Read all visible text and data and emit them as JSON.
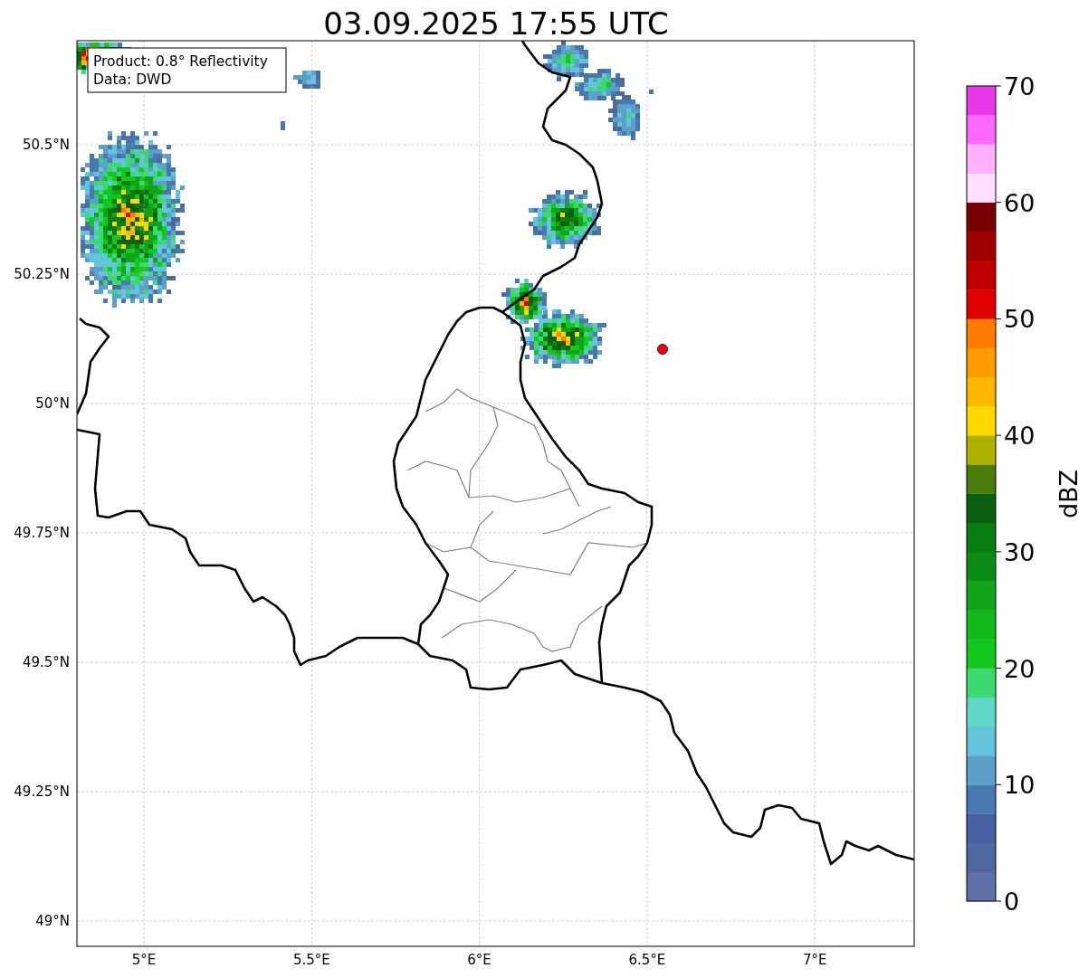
{
  "title": "03.09.2025 17:55 UTC",
  "map": {
    "info_box": [
      "Product: 0.8° Reflectivity",
      "Data: DWD"
    ],
    "lat_ticks": [
      "50.5°N",
      "50.25°N",
      "50°N",
      "49.75°N",
      "49.5°N",
      "49.25°N",
      "49°N"
    ],
    "lon_ticks": [
      "5°E",
      "5.5°E",
      "6°E",
      "6.5°E",
      "7°E"
    ]
  },
  "colorbar": {
    "label": "dBZ",
    "ticks": [
      "70",
      "60",
      "50",
      "40",
      "30",
      "20",
      "10",
      "0"
    ],
    "bands": [
      {
        "color": "#6070a8"
      },
      {
        "color": "#5068a0"
      },
      {
        "color": "#4460a0"
      },
      {
        "color": "#4878b0"
      },
      {
        "color": "#5aa0c8"
      },
      {
        "color": "#64c4dc"
      },
      {
        "color": "#60d8c8"
      },
      {
        "color": "#3cd870"
      },
      {
        "color": "#12c81c"
      },
      {
        "color": "#10b81c"
      },
      {
        "color": "#10a418"
      },
      {
        "color": "#0c8c14"
      },
      {
        "color": "#0a7c14"
      },
      {
        "color": "#086010"
      },
      {
        "color": "#4a7a0a"
      },
      {
        "color": "#b0b000"
      },
      {
        "color": "#ffd800"
      },
      {
        "color": "#ffb800"
      },
      {
        "color": "#ff9c00"
      },
      {
        "color": "#ff7c00"
      },
      {
        "color": "#e00000"
      },
      {
        "color": "#c00000"
      },
      {
        "color": "#a00000"
      },
      {
        "color": "#780000"
      },
      {
        "color": "#ffe0ff"
      },
      {
        "color": "#ffb0ff"
      },
      {
        "color": "#ff68ff"
      },
      {
        "color": "#e838e8"
      }
    ]
  }
}
